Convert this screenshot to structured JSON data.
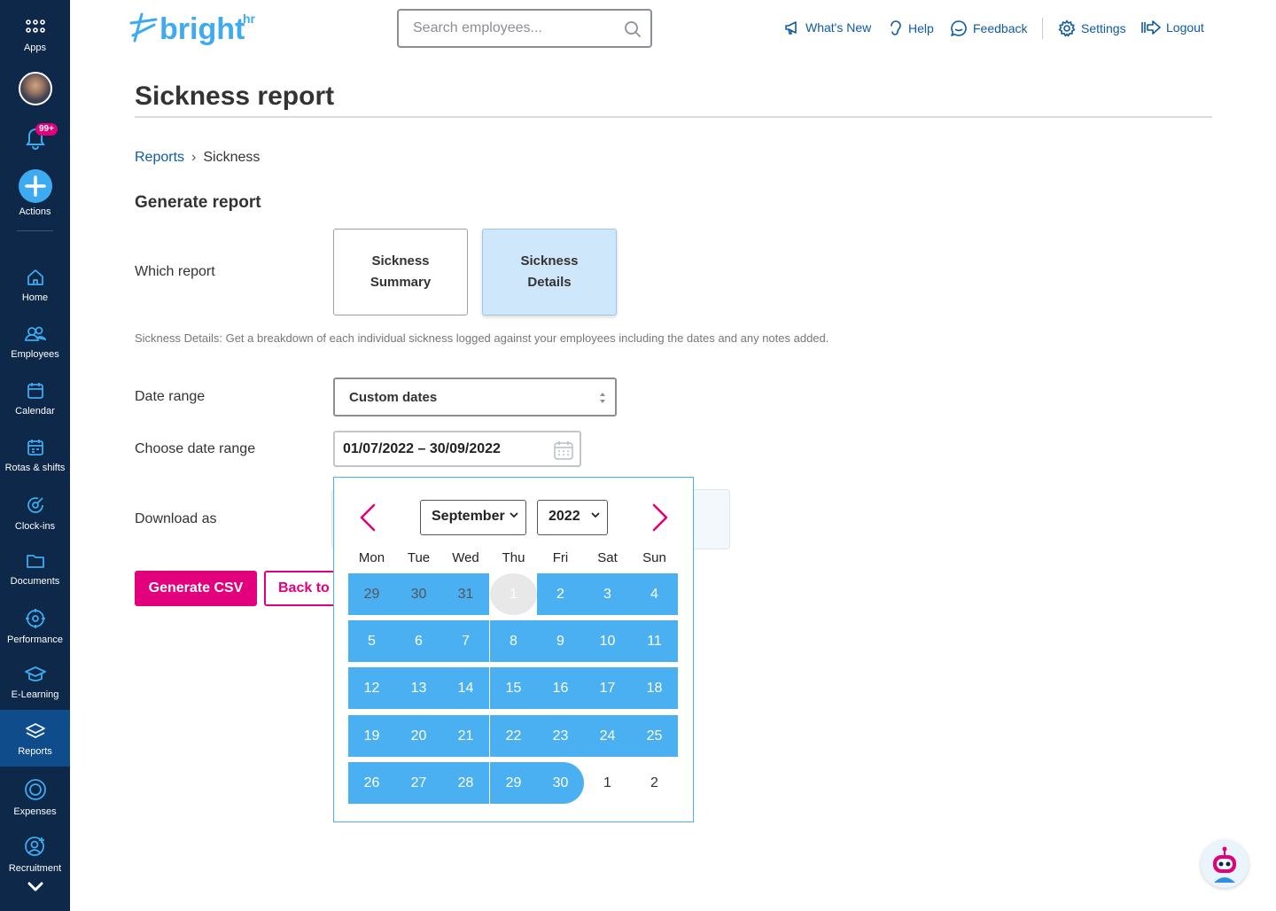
{
  "sidebar": {
    "apps": "Apps",
    "notifications_badge": "99+",
    "actions": "Actions",
    "items": [
      {
        "label": "Home",
        "icon": "home-icon"
      },
      {
        "label": "Employees",
        "icon": "employees-icon"
      },
      {
        "label": "Calendar",
        "icon": "calendar-icon"
      },
      {
        "label": "Rotas & shifts",
        "icon": "rotas-icon"
      },
      {
        "label": "Clock-ins",
        "icon": "clock-in-icon"
      },
      {
        "label": "Documents",
        "icon": "folder-icon"
      },
      {
        "label": "Performance",
        "icon": "performance-icon"
      },
      {
        "label": "E-Learning",
        "icon": "graduation-cap-icon"
      },
      {
        "label": "Reports",
        "icon": "layers-icon",
        "active": true
      },
      {
        "label": "Expenses",
        "icon": "expenses-icon"
      },
      {
        "label": "Recruitment",
        "icon": "recruitment-icon"
      }
    ]
  },
  "header": {
    "logo_text": "bright",
    "logo_suffix": "hr",
    "search_placeholder": "Search employees...",
    "links": {
      "whats_new": "What's New",
      "help": "Help",
      "feedback": "Feedback",
      "settings": "Settings",
      "logout": "Logout"
    }
  },
  "page": {
    "title": "Sickness report",
    "breadcrumb": {
      "parent": "Reports",
      "current": "Sickness"
    },
    "section_heading": "Generate report",
    "labels": {
      "which_report": "Which report",
      "date_range": "Date range",
      "choose_date_range": "Choose date range",
      "download_as": "Download as"
    },
    "report_options": {
      "summary_line1": "Sickness",
      "summary_line2": "Summary",
      "details_line1": "Sickness",
      "details_line2": "Details"
    },
    "report_description": "Sickness Details: Get a breakdown of each individual sickness logged against your employees including the dates and any notes added.",
    "date_range_value": "Custom dates",
    "range_input_value": "01/07/2022 – 30/09/2022",
    "generate_button": "Generate CSV",
    "back_button": "Back to"
  },
  "calendar": {
    "month": "September",
    "year": "2022",
    "weekdays": [
      "Mon",
      "Tue",
      "Wed",
      "Thu",
      "Fri",
      "Sat",
      "Sun"
    ],
    "weeks": [
      [
        "29",
        "30",
        "31",
        "1",
        "2",
        "3",
        "4"
      ],
      [
        "5",
        "6",
        "7",
        "8",
        "9",
        "10",
        "11"
      ],
      [
        "12",
        "13",
        "14",
        "15",
        "16",
        "17",
        "18"
      ],
      [
        "19",
        "20",
        "21",
        "22",
        "23",
        "24",
        "25"
      ],
      [
        "26",
        "27",
        "28",
        "29",
        "30",
        "1",
        "2"
      ]
    ],
    "colors": {
      "range": "#4ab0f2",
      "accent": "#e3007c",
      "sidebar": "#0d2849"
    }
  }
}
